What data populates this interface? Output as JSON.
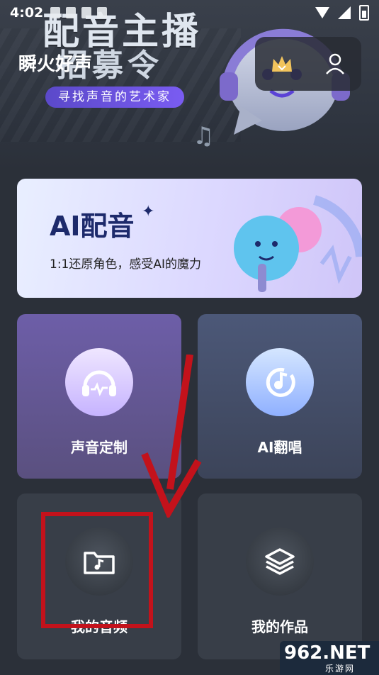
{
  "status_bar": {
    "time": "4:02"
  },
  "hero": {
    "title_line1": "配音主播",
    "title_line2": "招募令",
    "app_name": "瞬火好声",
    "slogan": "寻找声音的艺术家"
  },
  "top_actions": {
    "icons": [
      "crown-icon",
      "user-icon"
    ]
  },
  "ai_banner": {
    "title": "AI配音",
    "subtitle": "1:1还原角色，感受AI的魔力"
  },
  "tiles": [
    {
      "label": "声音定制",
      "icon": "headphones-icon"
    },
    {
      "label": "AI翻唱",
      "icon": "music-disc-icon"
    },
    {
      "label": "我的音频",
      "icon": "music-folder-icon"
    },
    {
      "label": "我的作品",
      "icon": "layers-icon"
    }
  ],
  "watermark": {
    "logo": "962",
    "logo_suffix": ".NET",
    "sub": "乐游网"
  },
  "colors": {
    "background": "#2b3039",
    "highlight": "#c3121b",
    "slogan_bg": "#6a54e0"
  }
}
